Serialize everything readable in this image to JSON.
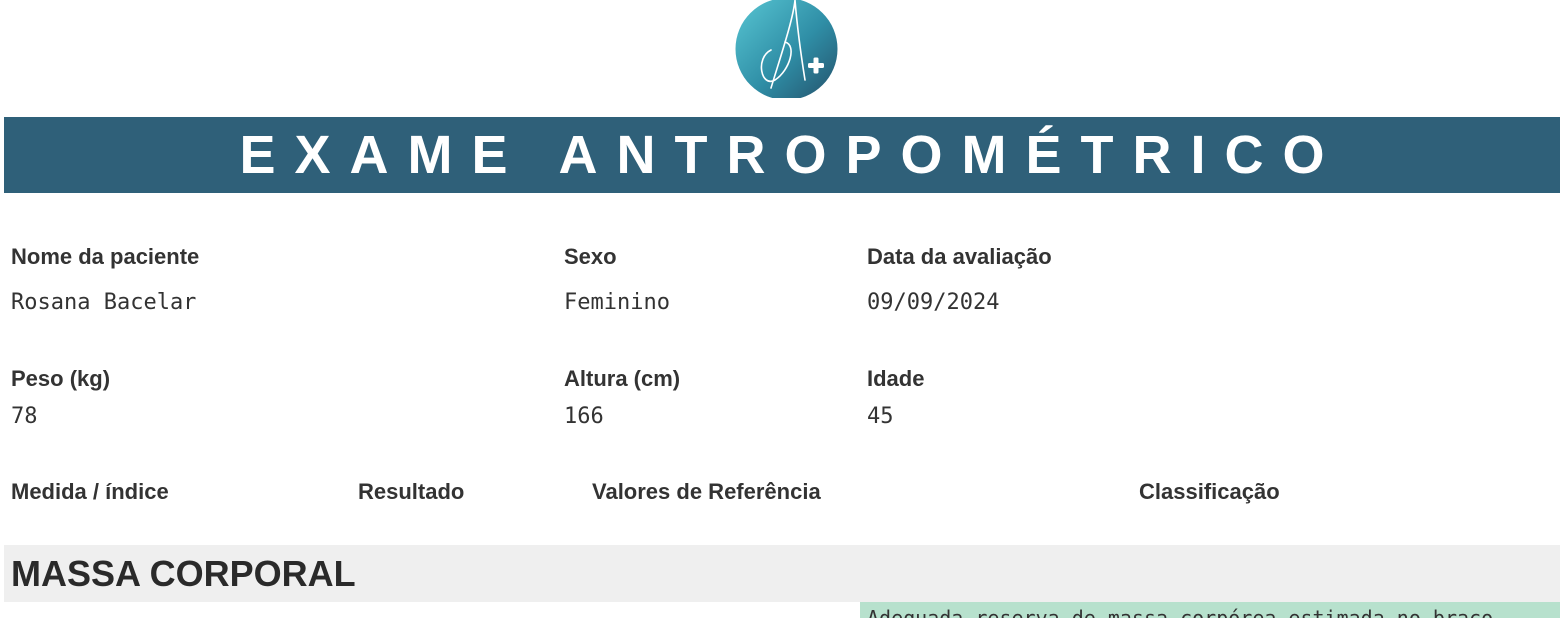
{
  "header": {
    "logo_icon": "a-plus-logo-icon",
    "title": "EXAME ANTROPOMÉTRICO",
    "accent_color": "#2f6079"
  },
  "patient": {
    "name_label": "Nome da paciente",
    "name_value": "Rosana Bacelar",
    "sex_label": "Sexo",
    "sex_value": "Feminino",
    "date_label": "Data da avaliação",
    "date_value": "09/09/2024",
    "weight_label": "Peso (kg)",
    "weight_value": "78",
    "height_label": "Altura (cm)",
    "height_value": "166",
    "age_label": "Idade",
    "age_value": "45"
  },
  "table": {
    "columns": [
      "Medida / índice",
      "Resultado",
      "Valores de Referência",
      "Classificação"
    ],
    "section_title": "MASSA CORPORAL",
    "first_row_classification": "Adequada reserva de massa corpórea estimada no braço",
    "classification_color": "#b7e1cd"
  }
}
